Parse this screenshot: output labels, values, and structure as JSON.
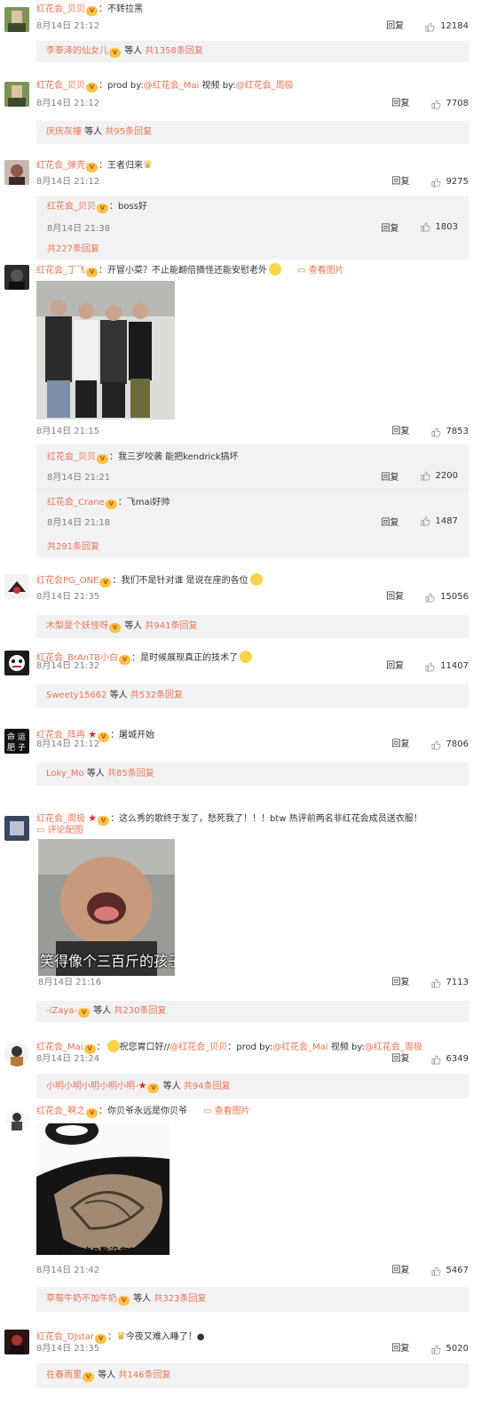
{
  "like_color": "#999999",
  "comments": [
    {
      "user": "红花会_贝贝",
      "text": "：不转拉黑",
      "time": "8月14日 21:12",
      "reply": "回复",
      "likes": "12184",
      "more": {
        "names": "李泰泽的仙女儿",
        "suffix": "等人",
        "count": "共1358条回复"
      }
    },
    {
      "user": "红花会_贝贝",
      "text": "：prod by:",
      "at1": "@红花会_Mai",
      "mid": " 视频 by:",
      "at2": "@红花会_周极",
      "time": "8月14日 21:12",
      "reply": "回复",
      "likes": "7708",
      "more": {
        "names": "庆庆灰撞",
        "suffix": "等人",
        "count": "共95条回复"
      }
    },
    {
      "user": "红花会_弹壳",
      "text": "：王者归来",
      "time": "8月14日 21:12",
      "reply": "回复",
      "likes": "9275",
      "sub": {
        "user": "红花会_贝贝",
        "text": "：boss好",
        "time": "8月14日 21:38",
        "reply": "回复",
        "likes": "1803"
      },
      "more_total": "共227条回复"
    },
    {
      "user": "红花会_丁飞",
      "text": "：开冒小菜？不止能翻倍摘怪还能安慰老外",
      "view": "查看图片",
      "time": "8月14日 21:15",
      "reply": "回复",
      "likes": "7853",
      "subs": [
        {
          "user": "红花会_贝贝",
          "text": "：我三岁咬袭 能把kendrick搞坏",
          "time": "8月14日 21:21",
          "reply": "回复",
          "likes": "2200"
        },
        {
          "user": "红花会_Crane",
          "text": "：飞mai好帅",
          "time": "8月14日 21:18",
          "reply": "回复",
          "likes": "1487"
        }
      ],
      "more_total": "共291条回复"
    },
    {
      "user": "红花会PG_ONE",
      "text": "：我们不是针对谁 是说在座的各位",
      "time": "8月14日 21:35",
      "reply": "回复",
      "likes": "15056",
      "more": {
        "names": "木梨是个妖怪呀",
        "suffix": "等人",
        "count": "共941条回复"
      }
    },
    {
      "user": "红花会_BrAnTB小白",
      "text": "：是时候展现真正的技术了",
      "time": "8月14日 21:32",
      "reply": "回复",
      "likes": "11407",
      "more": {
        "names": "Sweety15662",
        "suffix": "等人",
        "count": "共532条回复"
      }
    },
    {
      "user": "红花会_阵冉",
      "text": "：屠城开始",
      "time": "8月14日 21:12",
      "reply": "回复",
      "likes": "7806",
      "more": {
        "names": "Loky_Mo",
        "suffix": "等人",
        "count": "共85条回复"
      }
    },
    {
      "user": "红花会_周极",
      "text": "：这么秀的歌终于发了，愁死我了！！！btw 热评前两名非红花会成员送衣服！",
      "view": "评论配图",
      "caption": "笑得像个三百斤的孩子",
      "time": "8月14日 21:16",
      "reply": "回复",
      "likes": "7113",
      "more": {
        "names": "-iZaya-",
        "suffix": "等人",
        "count": "共230条回复"
      }
    },
    {
      "user": "红花会_Mai",
      "text": "祝您胃口好//",
      "at1": "@红花会_贝贝",
      "mid": "：prod by:",
      "at2": "@红花会_Mai",
      "mid2": " 视频 by:",
      "at3": "@红花会_周极",
      "time": "8月14日 21:24",
      "reply": "回复",
      "likes": "6349",
      "more": {
        "names": "小明小明小明小明小明-",
        "suffix": "等人",
        "count": "共94条回复"
      }
    },
    {
      "user": "红花会_啊之",
      "text": "：你贝爷永远是你贝爷",
      "view": "查看图片",
      "caption": "你今里，卡B数没有？",
      "time": "8月14日 21:42",
      "reply": "回复",
      "likes": "5467",
      "more": {
        "names": "草莓牛奶不加牛奶",
        "suffix": "等人",
        "count": "共323条回复"
      }
    },
    {
      "user": "红花会_DJstar",
      "text": "今夜又难入睡了！",
      "time": "8月14日 21:35",
      "reply": "回复",
      "likes": "5020",
      "more": {
        "names": "在春雨里",
        "suffix": "等人",
        "count": "共146条回复"
      }
    }
  ]
}
